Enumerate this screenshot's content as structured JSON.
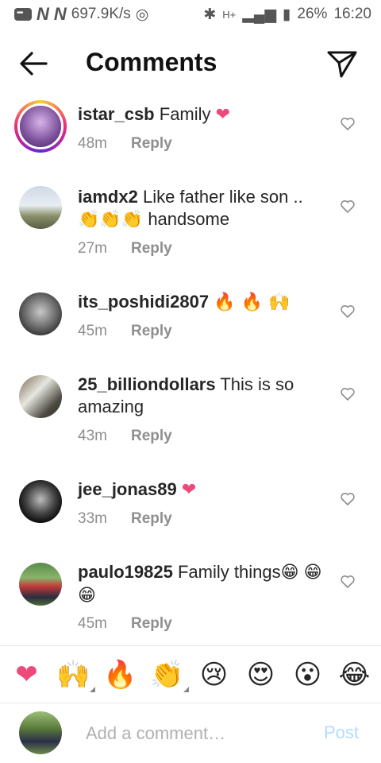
{
  "status_bar": {
    "speed": "697.9K/s",
    "network": "H+",
    "battery": "26%",
    "time": "16:20"
  },
  "header": {
    "title": "Comments",
    "back_icon": "arrow-left-icon",
    "send_icon": "paper-plane-icon"
  },
  "comments": [
    {
      "username": "istar_csb",
      "text": "Family",
      "emojis": "❤",
      "time": "48m",
      "reply_label": "Reply",
      "has_story": true
    },
    {
      "username": "iamdx2",
      "text": "Like father like son ..",
      "emojis": "👏👏👏",
      "text_after": "handsome",
      "time": "27m",
      "reply_label": "Reply"
    },
    {
      "username": "its_poshidi2807",
      "text": "",
      "emojis": "🔥 🔥 🙌",
      "time": "45m",
      "reply_label": "Reply"
    },
    {
      "username": "25_billiondollars",
      "text": "This is so amazing",
      "emojis": "",
      "time": "43m",
      "reply_label": "Reply"
    },
    {
      "username": "jee_jonas89",
      "text": "",
      "emojis": "❤",
      "time": "33m",
      "reply_label": "Reply"
    },
    {
      "username": "paulo19825",
      "text": "Family things",
      "emojis": "😁",
      "text_after_emojis": "😁😁",
      "time": "45m",
      "reply_label": "Reply"
    }
  ],
  "emoji_tray": [
    "❤",
    "🙌",
    "🔥",
    "👏",
    "😢",
    "😍",
    "😮",
    "😂"
  ],
  "composer": {
    "placeholder": "Add a comment…",
    "post_label": "Post"
  },
  "colors": {
    "heart": "#ed4a7b",
    "post_disabled": "#b3dbff",
    "meta_gray": "#8e8e8e"
  }
}
